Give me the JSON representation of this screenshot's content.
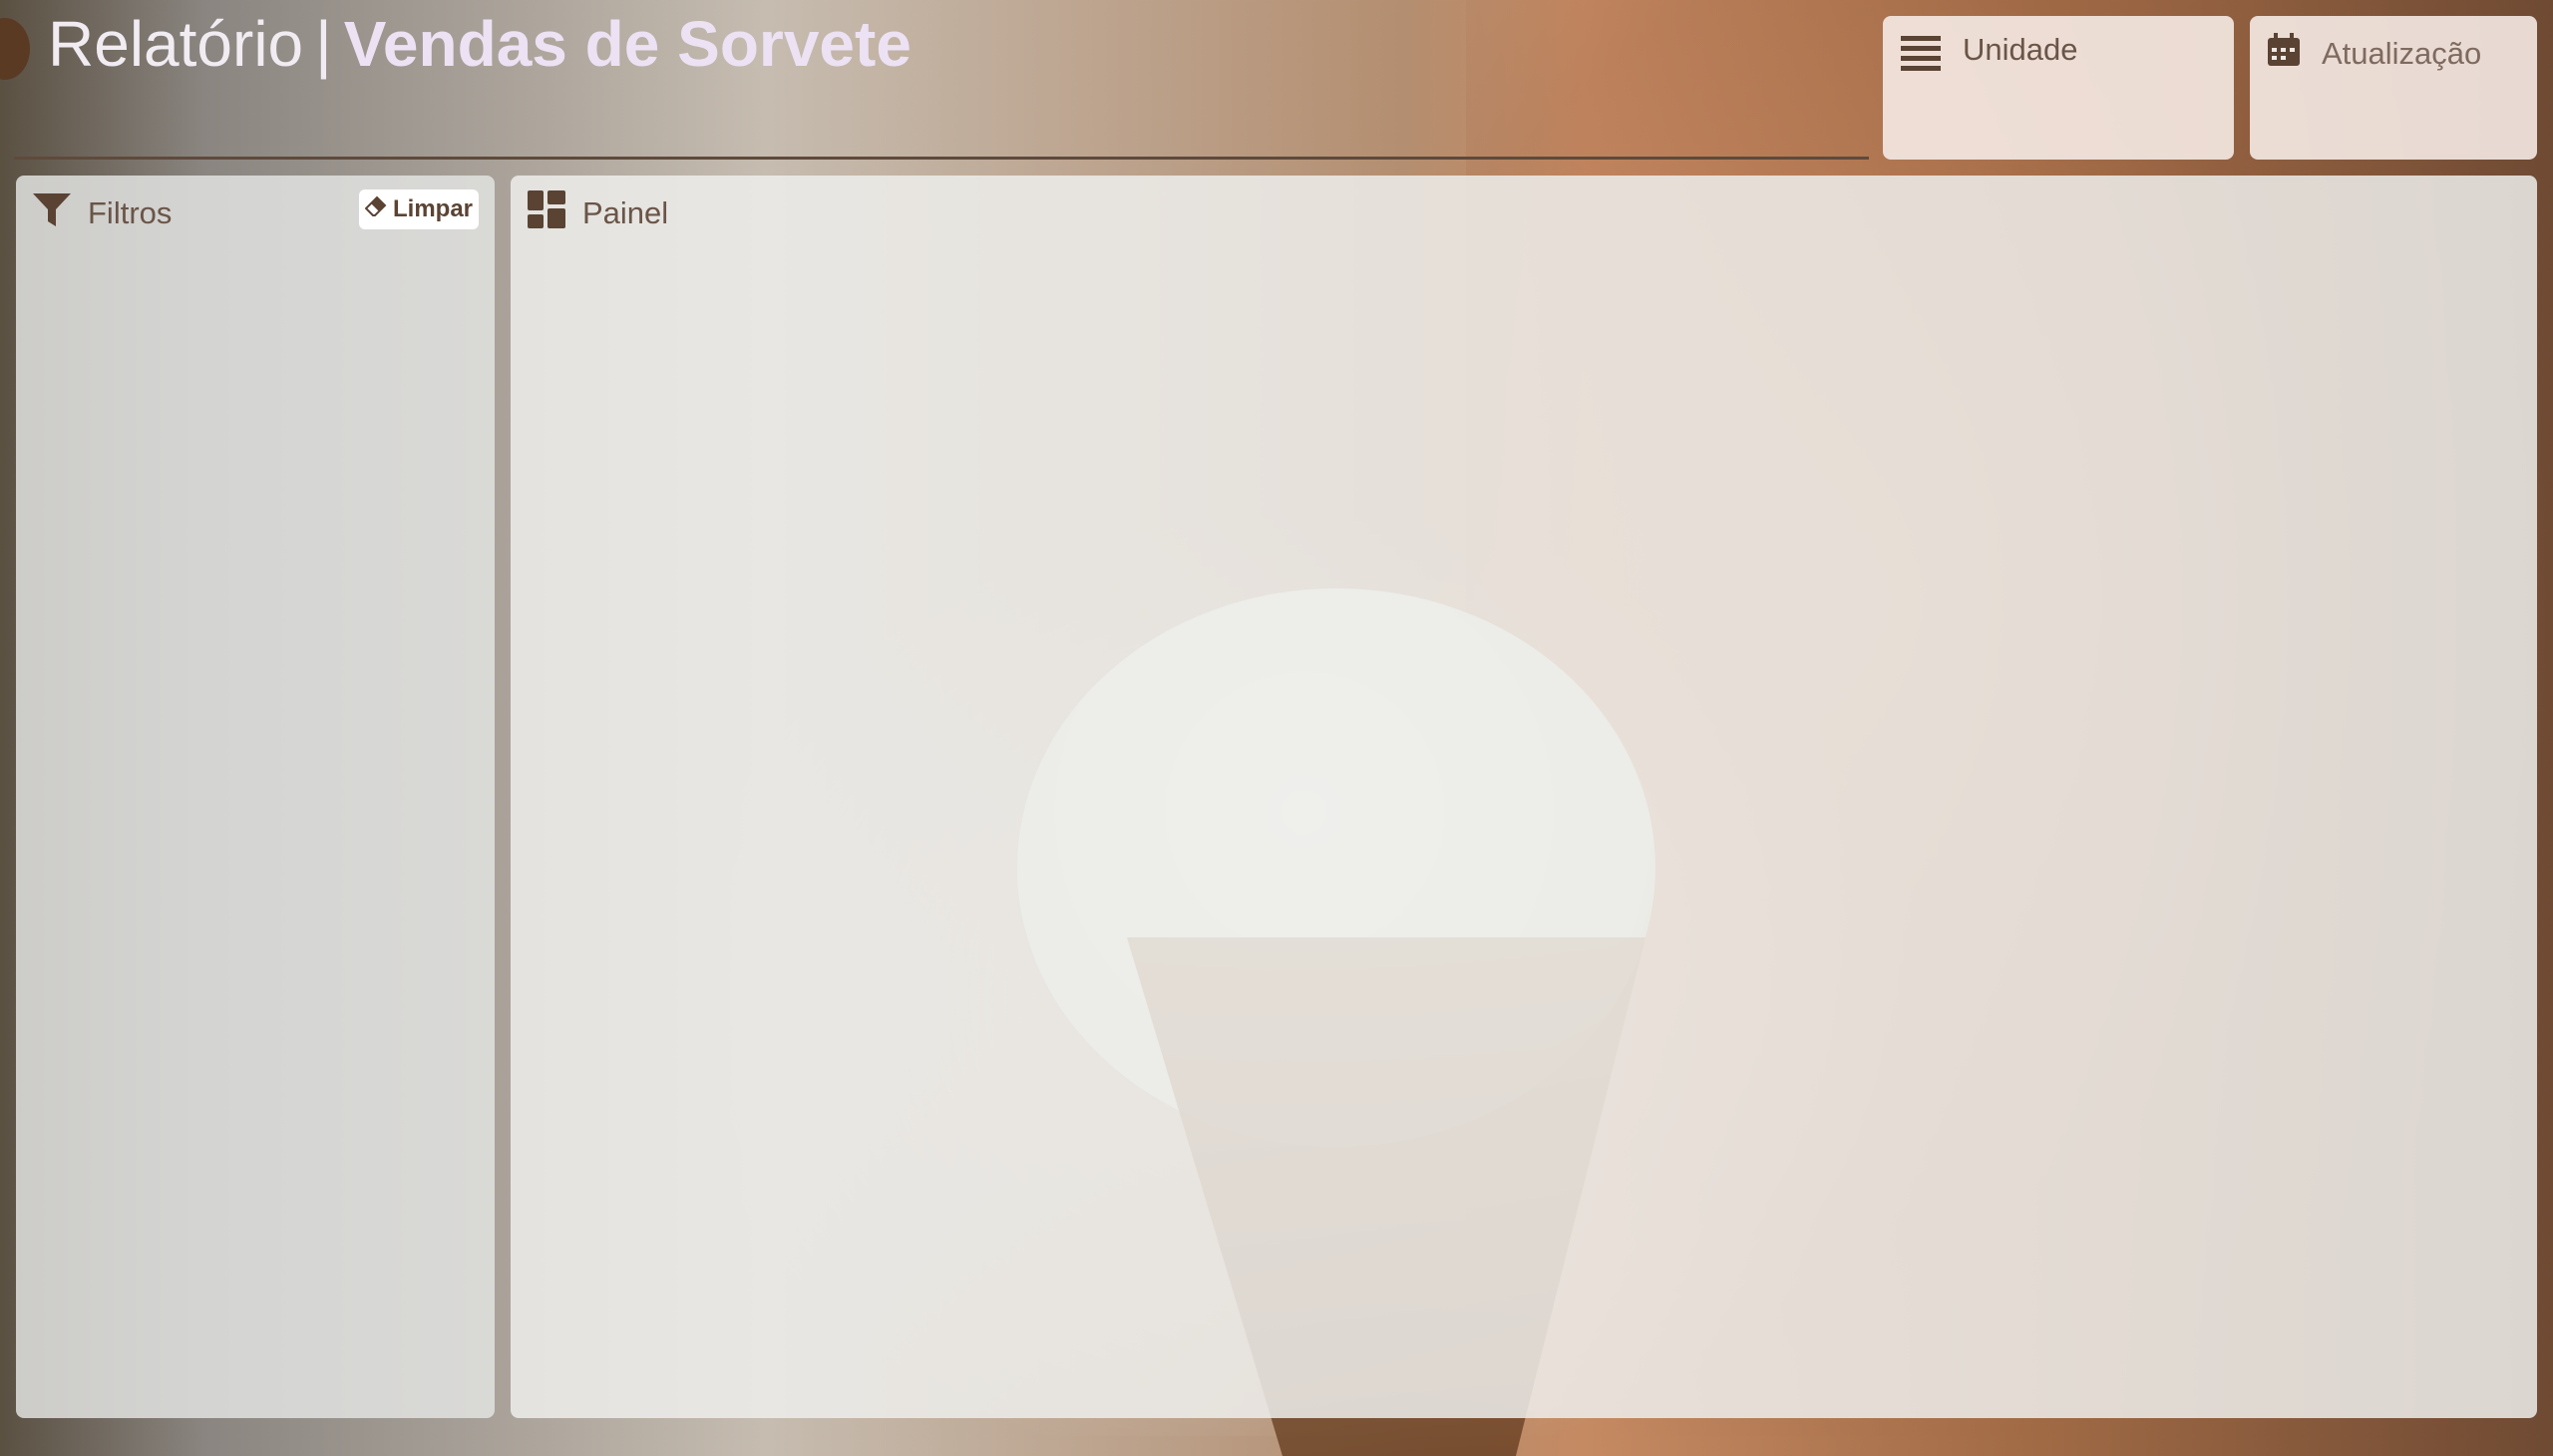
{
  "header": {
    "title_light": "Relatório",
    "separator": "|",
    "title_bold": "Vendas de Sorvete"
  },
  "cards": {
    "unidade": {
      "label": "Unidade",
      "icon": "list-icon"
    },
    "atualizacao": {
      "label": "Atualização",
      "icon": "calendar-icon"
    }
  },
  "filters": {
    "title": "Filtros",
    "icon": "filter-icon",
    "clear_button": {
      "label": "Limpar",
      "icon": "eraser-icon"
    }
  },
  "panel": {
    "title": "Painel",
    "icon": "dashboard-icon"
  },
  "colors": {
    "accent_brown": "#5b3a24",
    "text_brown": "#6a5548",
    "title_color": "#f1ecf2"
  }
}
